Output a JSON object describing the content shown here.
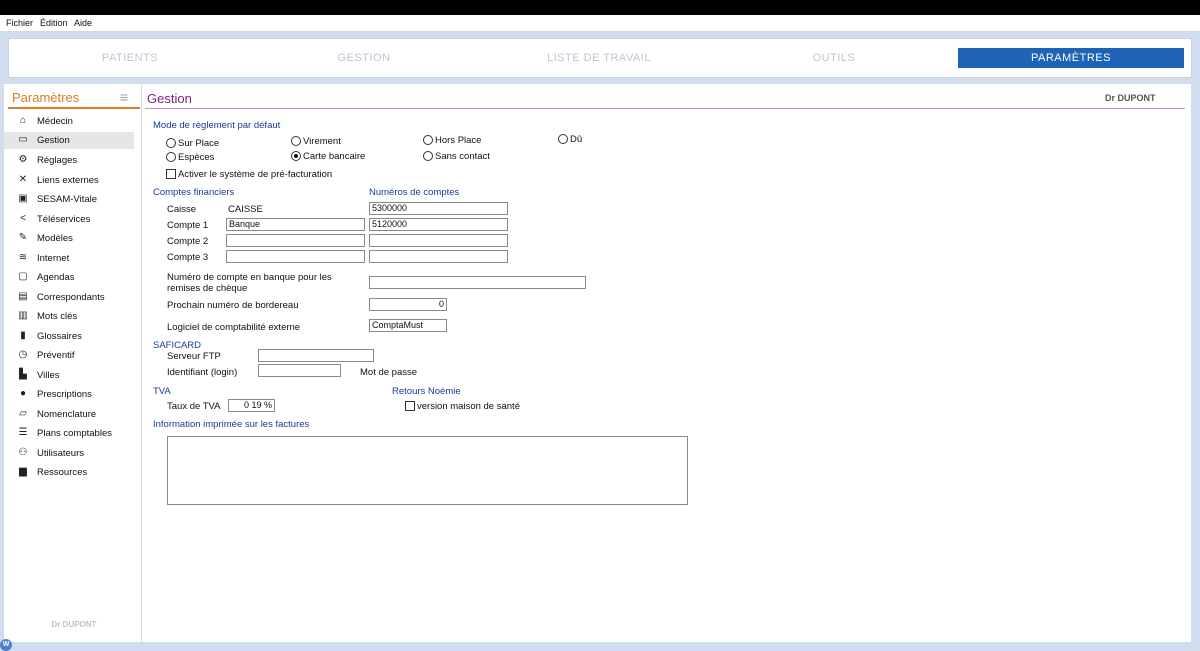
{
  "menubar": {
    "items": [
      "Fichier",
      "Édition",
      "Aide"
    ]
  },
  "nav": {
    "tabs": [
      "PATIENTS",
      "GESTION",
      "LISTE DE TRAVAIL",
      "OUTILS",
      "PARAMÈTRES"
    ],
    "active": "PARAMÈTRES"
  },
  "sidebar": {
    "title": "Paramètres",
    "menu_icon": "hamburger-icon",
    "items": [
      {
        "label": "Médecin",
        "icon": "home-icon"
      },
      {
        "label": "Gestion",
        "icon": "inbox-icon"
      },
      {
        "label": "Réglages",
        "icon": "gears-icon"
      },
      {
        "label": "Liens externes",
        "icon": "expand-icon"
      },
      {
        "label": "SESAM-Vitale",
        "icon": "card-icon"
      },
      {
        "label": "Téléservices",
        "icon": "share-icon"
      },
      {
        "label": "Modèles",
        "icon": "edit-icon"
      },
      {
        "label": "Internet",
        "icon": "wifi-icon"
      },
      {
        "label": "Agendas",
        "icon": "calendar-icon"
      },
      {
        "label": "Correspondants",
        "icon": "contact-icon"
      },
      {
        "label": "Mots clés",
        "icon": "chart-icon"
      },
      {
        "label": "Glossaires",
        "icon": "clipboard-icon"
      },
      {
        "label": "Préventif",
        "icon": "clock-icon"
      },
      {
        "label": "Villes",
        "icon": "buildings-icon"
      },
      {
        "label": "Prescriptions",
        "icon": "pills-icon"
      },
      {
        "label": "Nomenclature",
        "icon": "folder-icon"
      },
      {
        "label": "Plans comptables",
        "icon": "list-icon"
      },
      {
        "label": "Utilisateurs",
        "icon": "users-icon"
      },
      {
        "label": "Ressources",
        "icon": "car-icon"
      }
    ],
    "active": "Gestion",
    "footer": "Dr DUPONT"
  },
  "main": {
    "title": "Gestion",
    "doctor": "Dr DUPONT",
    "payment": {
      "heading": "Mode de règlement par défaut",
      "options": [
        "Sur Place",
        "Virement",
        "Hors Place",
        "Dû",
        "Espèces",
        "Carte bancaire",
        "Sans contact"
      ],
      "selected": "Carte bancaire",
      "prefacturation_label": "Activer le système de pré-facturation"
    },
    "accounts": {
      "heading": "Comptes financiers",
      "numbers_heading": "Numéros de comptes",
      "rows": [
        {
          "label": "Caisse",
          "name": "CAISSE",
          "number": "5300000"
        },
        {
          "label": "Compte 1",
          "name": "Banque",
          "number": "5120000"
        },
        {
          "label": "Compte 2",
          "name": "",
          "number": ""
        },
        {
          "label": "Compte 3",
          "name": "",
          "number": ""
        }
      ],
      "cheque_label": "Numéro de compte en banque pour les remises de chèque",
      "cheque_value": "",
      "bordereau_label": "Prochain numéro de bordereau",
      "bordereau_value": "0",
      "software_label": "Logiciel de comptabilité externe",
      "software_value": "ComptaMust"
    },
    "saficard": {
      "heading": "SAFICARD",
      "ftp_label": "Serveur FTP",
      "ftp_value": "",
      "login_label": "Identifiant (login)",
      "login_value": "",
      "password_label": "Mot de passe"
    },
    "tva": {
      "heading": "TVA",
      "rate_label": "Taux de TVA",
      "rate_value": "0 19 %"
    },
    "noemie": {
      "heading": "Retours Noémie",
      "option_label": "version maison de santé"
    },
    "invoice": {
      "heading": "Information imprimée sur les factures",
      "text": ""
    }
  }
}
